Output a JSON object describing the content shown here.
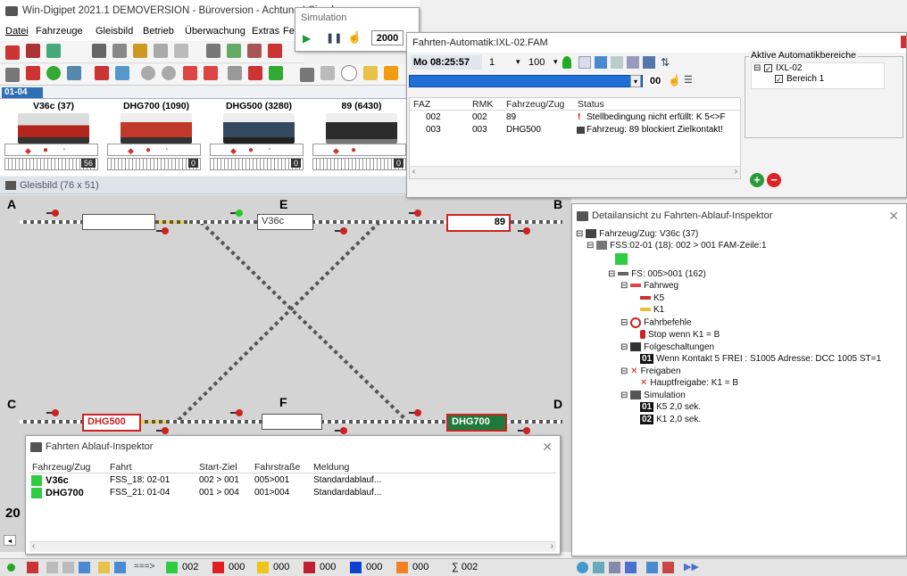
{
  "app": {
    "title": "Win-Digipet 2021.1 DEMOVERSION - Büroversion - Achtung ! Simula",
    "menu": [
      "Datei",
      "Fahrzeuge",
      "Gleisbild",
      "Betrieb",
      "Überwachung",
      "Extras",
      "Fen:"
    ]
  },
  "simulation": {
    "title": "Simulation",
    "speed": "2000"
  },
  "fam": {
    "title": "Fahrten-Automatik:IXL-02.FAM",
    "time": "Mo 08:25:57",
    "field1": "1",
    "field2": "100",
    "progress_label": "00",
    "columns": [
      "FAZ",
      "RMK",
      "Fahrzeug/Zug",
      "Status"
    ],
    "rows": [
      {
        "faz": "002",
        "rmk": "002",
        "zug": "89",
        "status": "Stellbedingung nicht erfüllt: K 5<>F"
      },
      {
        "faz": "003",
        "rmk": "003",
        "zug": "DHG500",
        "status": "Fahrzeug: 89 blockiert Zielkontakt!"
      }
    ],
    "areas_title": "Aktive Automatikbereiche",
    "areas": [
      "IXL-02",
      "Bereich 1"
    ]
  },
  "locos": {
    "tab": "01-04",
    "cards": [
      {
        "name": "V36c (37)",
        "speed": "56",
        "color": "#b3261e"
      },
      {
        "name": "DHG700 (1090)",
        "speed": "0",
        "color": "#c0392b"
      },
      {
        "name": "DHG500 (3280)",
        "speed": "0",
        "color": "#34495e"
      },
      {
        "name": "89 (6430)",
        "speed": "0",
        "color": "#2c2c2c"
      }
    ]
  },
  "gleisbild": {
    "title": "Gleisbild (76 x 51)",
    "corners": {
      "a": "A",
      "b": "B",
      "c": "C",
      "d": "D",
      "e": "E",
      "f": "F"
    },
    "boxes": {
      "top_mid": "V36c",
      "top_right": "89",
      "bottom_left": "DHG500",
      "bottom_right": "DHG700"
    },
    "left_number": "20"
  },
  "inspector": {
    "title": "Fahrten Ablauf-Inspektor",
    "columns": [
      "Fahrzeug/Zug",
      "Fahrt",
      "Start-Ziel",
      "Fahrstraße",
      "Meldung"
    ],
    "rows": [
      {
        "zug": "V36c",
        "fahrt": "FSS_18: 02-01",
        "sz": "002 > 001",
        "fs": "005>001",
        "msg": "Standardablauf..."
      },
      {
        "zug": "DHG700",
        "fahrt": "FSS_21: 01-04",
        "sz": "001 > 004",
        "fs": "001>004",
        "msg": "Standardablauf..."
      }
    ]
  },
  "detail": {
    "title": "Detailansicht zu Fahrten-Ablauf-Inspektor",
    "tree": [
      "Fahrzeug/Zug: V36c (37)",
      "FSS:02-01 (18): 002 > 001  FAM-Zeile:1",
      "FS: 005>001 (162)",
      "Fahrweg",
      "K5",
      "K1",
      "Fahrbefehle",
      "Stop wenn K1 = B",
      "Folgeschaltungen",
      "Wenn Kontakt 5 FREI   : S1005 Adresse: DCC 1005 ST=1",
      "Freigaben",
      "Hauptfreigabe: K1 = B",
      "Simulation",
      "K5 2,0 sek.",
      "K1 2,0 sek."
    ],
    "badge1": "01",
    "badge2": "02",
    "badge_fs": "01"
  },
  "statusbar": {
    "arrow": "===>",
    "counts": [
      {
        "color": "#2ecc40",
        "value": "002"
      },
      {
        "color": "#e02020",
        "value": "000"
      },
      {
        "color": "#f0c419",
        "value": "000"
      },
      {
        "color": "#c02030",
        "value": "000"
      },
      {
        "color": "#1040d0",
        "value": "000"
      },
      {
        "color": "#f08020",
        "value": "000"
      }
    ],
    "sum": "∑ 002"
  }
}
